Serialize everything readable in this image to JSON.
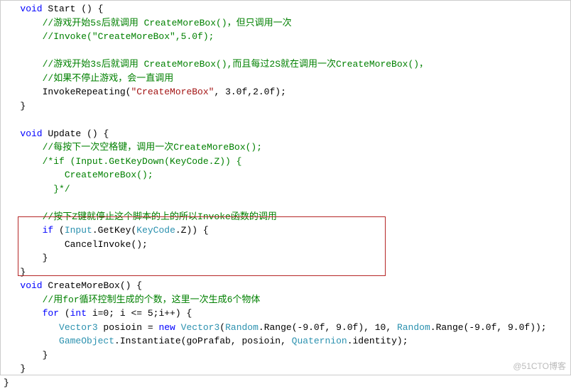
{
  "code": {
    "l1_kw": "void",
    "l1_fn": " Start () {",
    "l2_cmt": "//游戏开始5s后就调用 CreateMoreBox()，但只调用一次",
    "l3_cmt": "//Invoke(\"CreateMoreBox\",5.0f);",
    "l5_cmt": "//游戏开始3s后就调用 CreateMoreBox(),而且每过2S就在调用一次CreateMoreBox()，",
    "l6_cmt": "//如果不停止游戏，会一直调用",
    "l7a": "InvokeRepeating(",
    "l7_str": "\"CreateMoreBox\"",
    "l7b": ", 3.0f,2.0f);",
    "l8": "}",
    "l10_kw": "void",
    "l10_fn": " Update () {",
    "l11_cmt": "//每按下一次空格键，调用一次CreateMoreBox();",
    "l12_cmt": "/*if (Input.GetKeyDown(KeyCode.Z)) {",
    "l13_cmt": "    CreateMoreBox();",
    "l14_cmt": "  }*/",
    "l16_cmt": "//按下Z键就停止这个脚本的上的所以Invoke函数的调用",
    "l17_if": "if",
    "l17a": " (",
    "l17_t1": "Input",
    "l17b": ".GetKey(",
    "l17_t2": "KeyCode",
    "l17c": ".Z)) {",
    "l18": "CancelInvoke();",
    "l19": "}",
    "l20": "}",
    "l21_kw": "void",
    "l21_fn": " CreateMoreBox() {",
    "l22_cmt": "//用for循环控制生成的个数，这里一次生成6个物体",
    "l23_for": "for",
    "l23a": " (",
    "l23_int": "int",
    "l23b": " i=0; i <= 5;i++) {",
    "l24_t1": "Vector3",
    "l24a": " posioin = ",
    "l24_new": "new",
    "l24_sp": " ",
    "l24_t2": "Vector3",
    "l24b": "(",
    "l24_t3": "Random",
    "l24c": ".Range(-9.0f, 9.0f), 10, ",
    "l24_t4": "Random",
    "l24d": ".Range(-9.0f, 9.0f));",
    "l25_t1": "GameObject",
    "l25a": ".Instantiate(goPrafab, posioin, ",
    "l25_t2": "Quaternion",
    "l25b": ".identity);",
    "l26": "}",
    "l27": "}",
    "l28": "}"
  },
  "watermark": "@51CTO博客"
}
